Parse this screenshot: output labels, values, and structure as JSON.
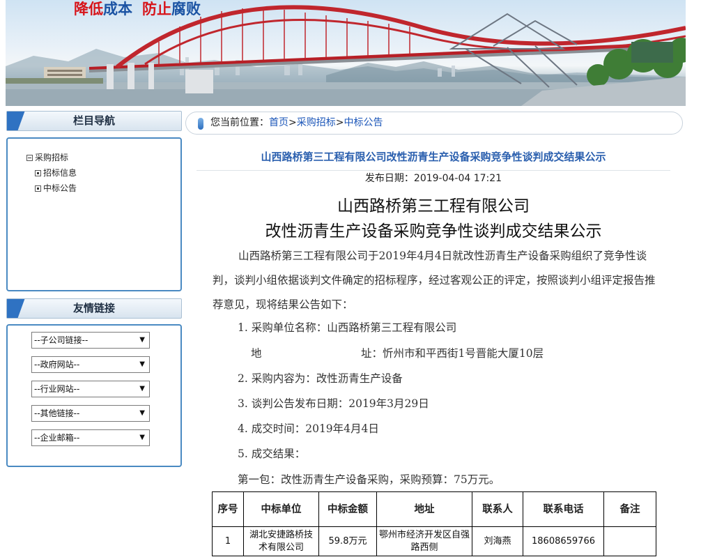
{
  "banner": {
    "slogan_part1_red": "降低",
    "slogan_part1_blue": "成本",
    "slogan_part2_red": "防止",
    "slogan_part2_blue": "腐败"
  },
  "sidebar": {
    "nav_title": "栏目导航",
    "tree": {
      "root": "采购招标",
      "children": [
        "招标信息",
        "中标公告"
      ]
    },
    "links_title": "友情链接",
    "link_selects": [
      "--子公司链接--",
      "--政府网站--",
      "--行业网站--",
      "--其他链接--",
      "--企业邮箱--"
    ]
  },
  "breadcrumb": {
    "prefix": "您当前位置：",
    "items": [
      "首页",
      "采购招标",
      "中标公告"
    ],
    "separator": ">"
  },
  "article": {
    "title": "山西路桥第三工程有限公司改性沥青生产设备采购竞争性谈判成交结果公示",
    "publish_label": "发布日期：",
    "publish_date": "2019-04-04 17:21",
    "heading_line1": "山西路桥第三工程有限公司",
    "heading_line2": "改性沥青生产设备采购竞争性谈判成交结果公示",
    "intro": "山西路桥第三工程有限公司于2019年4月4日就改性沥青生产设备采购组织了竞争性谈判，谈判小组依据谈判文件确定的招标程序，经过客观公正的评定，按照谈判小组评定报告推荐意见，现将结果公告如下：",
    "item1": "1. 采购单位名称：山西路桥第三工程有限公司",
    "address_label_a": "地",
    "address_label_b": "址：忻州市和平西街1号晋能大厦10层",
    "item2": "2. 采购内容为：改性沥青生产设备",
    "item3": "3. 谈判公告发布日期：2019年3月29日",
    "item4": "4. 成交时间：2019年4月4日",
    "item5": "5. 成交结果：",
    "package": "第一包：改性沥青生产设备采购，采购预算：75万元。"
  },
  "result_table": {
    "headers": [
      "序号",
      "中标单位",
      "中标金额",
      "地址",
      "联系人",
      "联系电话",
      "备注"
    ],
    "rows": [
      [
        "1",
        "湖北安捷路桥技术有限公司",
        "59.8万元",
        "鄂州市经济开发区自强路西侧",
        "刘海燕",
        "18608659766",
        ""
      ]
    ]
  },
  "colors": {
    "accent_blue": "#2a5fae",
    "link_blue": "#1a55b8",
    "slogan_red": "#d7141a",
    "box_border": "#4a8ac2"
  }
}
